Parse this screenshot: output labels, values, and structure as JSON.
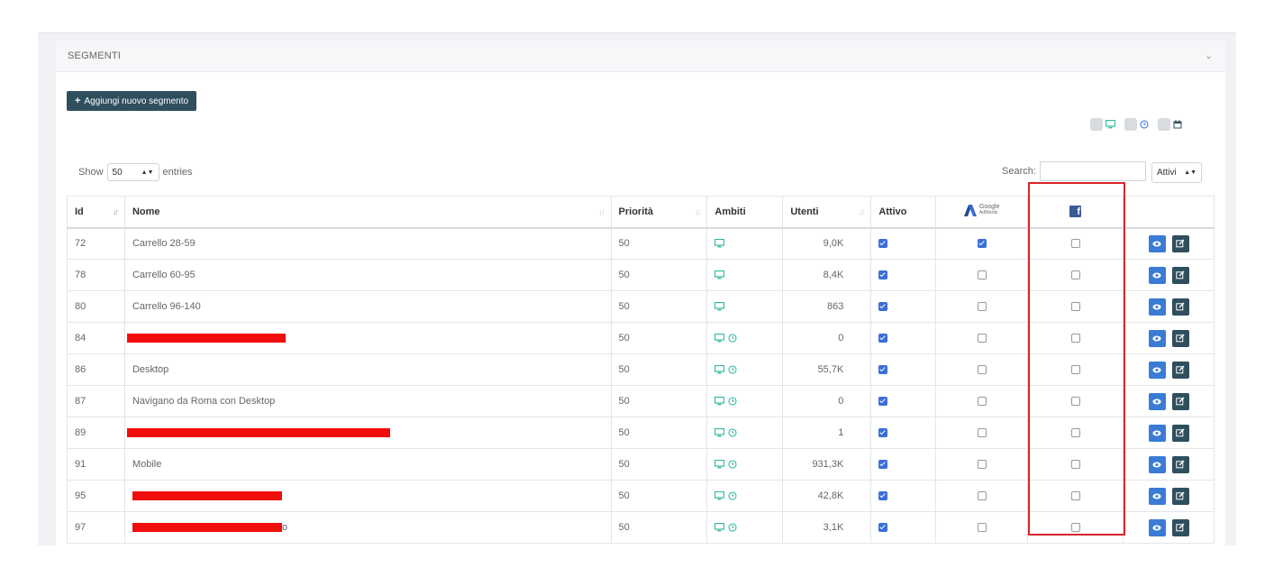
{
  "panel": {
    "title": "SEGMENTI"
  },
  "toolbar": {
    "add_label": "Aggiungi nuovo segmento"
  },
  "length_menu": {
    "prefix": "Show",
    "value": "50",
    "suffix": "entries"
  },
  "search": {
    "label": "Search:",
    "value": "",
    "status_filter": "Attivi"
  },
  "columns": {
    "id": "Id",
    "nome": "Nome",
    "priorita": "Priorità",
    "ambiti": "Ambiti",
    "utenti": "Utenti",
    "attivo": "Attivo",
    "adwords_top": "Google",
    "adwords_bottom": "AdWords",
    "facebook_glyph": "f"
  },
  "rows": [
    {
      "id": "72",
      "nome": "Carrello 28-59",
      "priorita": "50",
      "ambiti": [
        "desktop"
      ],
      "utenti": "9,0K",
      "attivo": true,
      "adwords": true,
      "facebook": false,
      "redacted": false
    },
    {
      "id": "78",
      "nome": "Carrello 60-95",
      "priorita": "50",
      "ambiti": [
        "desktop"
      ],
      "utenti": "8,4K",
      "attivo": true,
      "adwords": false,
      "facebook": false,
      "redacted": false
    },
    {
      "id": "80",
      "nome": "Carrello 96-140",
      "priorita": "50",
      "ambiti": [
        "desktop"
      ],
      "utenti": "863",
      "attivo": true,
      "adwords": false,
      "facebook": false,
      "redacted": false
    },
    {
      "id": "84",
      "nome": "",
      "priorita": "50",
      "ambiti": [
        "desktop",
        "time"
      ],
      "utenti": "0",
      "attivo": true,
      "adwords": false,
      "facebook": false,
      "redacted": true
    },
    {
      "id": "86",
      "nome": "Desktop",
      "priorita": "50",
      "ambiti": [
        "desktop",
        "time"
      ],
      "utenti": "55,7K",
      "attivo": true,
      "adwords": false,
      "facebook": false,
      "redacted": false
    },
    {
      "id": "87",
      "nome": "Navigano da Roma con Desktop",
      "priorita": "50",
      "ambiti": [
        "desktop",
        "time"
      ],
      "utenti": "0",
      "attivo": true,
      "adwords": false,
      "facebook": false,
      "redacted": false
    },
    {
      "id": "89",
      "nome": "",
      "priorita": "50",
      "ambiti": [
        "desktop",
        "time"
      ],
      "utenti": "1",
      "attivo": true,
      "adwords": false,
      "facebook": false,
      "redacted": true
    },
    {
      "id": "91",
      "nome": "Mobile",
      "priorita": "50",
      "ambiti": [
        "desktop",
        "time"
      ],
      "utenti": "931,3K",
      "attivo": true,
      "adwords": false,
      "facebook": false,
      "redacted": false
    },
    {
      "id": "95",
      "nome": "",
      "priorita": "50",
      "ambiti": [
        "desktop",
        "time"
      ],
      "utenti": "42,8K",
      "attivo": true,
      "adwords": false,
      "facebook": false,
      "redacted": true
    },
    {
      "id": "97",
      "nome": "o",
      "priorita": "50",
      "ambiti": [
        "desktop",
        "time"
      ],
      "utenti": "3,1K",
      "attivo": true,
      "adwords": false,
      "facebook": false,
      "redacted": true
    }
  ],
  "colors": {
    "accent": "#2f4f5e",
    "check": "#3a6fd8",
    "view": "#3a7bd5",
    "redaction": "#f20d0d",
    "highlight": "#d9262a",
    "scope_icon": "#2fb9a0"
  }
}
